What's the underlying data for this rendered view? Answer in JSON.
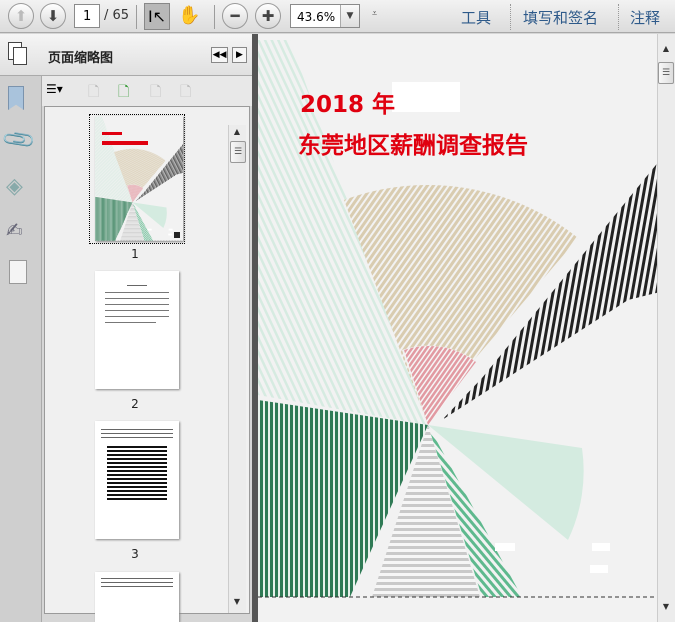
{
  "toolbar": {
    "current_page": "1",
    "total_pages": "/ 65",
    "zoom": "43.6%",
    "tools": "工具",
    "fill_sign": "填写和签名",
    "comment": "注释"
  },
  "panel": {
    "title": "页面缩略图"
  },
  "thumbnails": [
    {
      "label": "1"
    },
    {
      "label": "2"
    },
    {
      "label": "3"
    }
  ],
  "document": {
    "title_year": "2018 年",
    "title_main": "东莞地区薪酬调查报告"
  },
  "colors": {
    "title_red": "#e0000f",
    "beige": "#d9ccb0",
    "pink": "#e29aa2",
    "dark_green": "#2f7a55",
    "pale_green": "#d4ebe0"
  }
}
